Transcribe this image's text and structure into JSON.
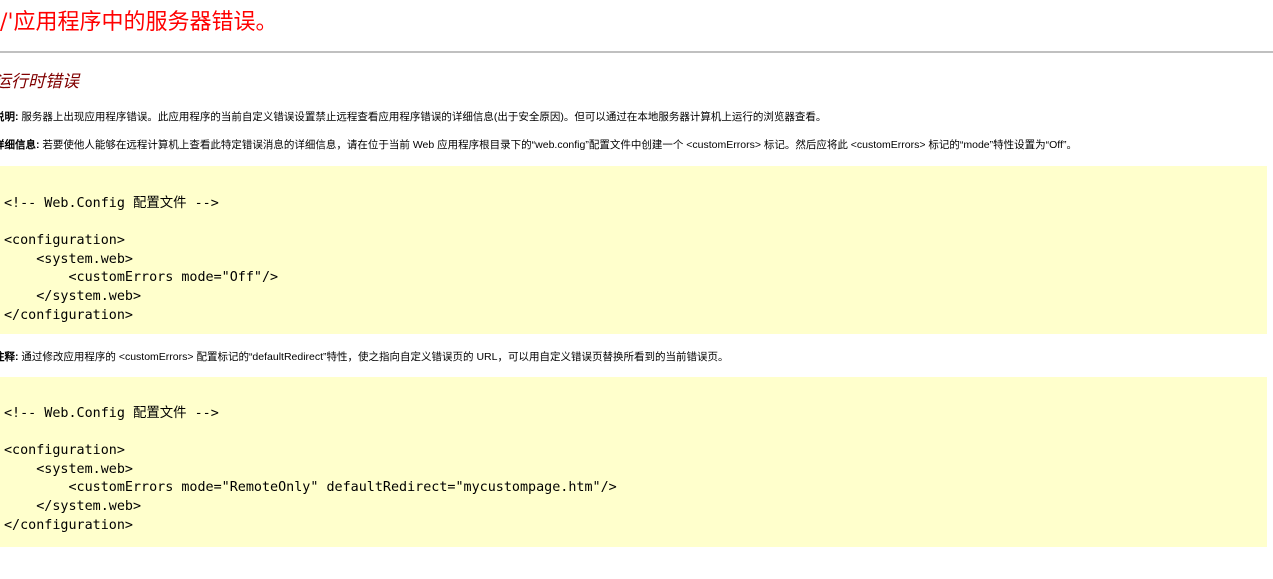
{
  "page": {
    "title": "'/'应用程序中的服务器错误。",
    "error_heading": "运行时错误",
    "description": {
      "label": "说明:",
      "text": " 服务器上出现应用程序错误。此应用程序的当前自定义错误设置禁止远程查看应用程序错误的详细信息(出于安全原因)。但可以通过在本地服务器计算机上运行的浏览器查看。"
    },
    "details": {
      "label": "详细信息:",
      "text": " 若要使他人能够在远程计算机上查看此特定错误消息的详细信息，请在位于当前 Web 应用程序根目录下的“web.config”配置文件中创建一个 <customErrors> 标记。然后应将此 <customErrors> 标记的“mode”特性设置为“Off”。"
    },
    "code_block_1": "<!-- Web.Config 配置文件 -->\n\n<configuration>\n    <system.web>\n        <customErrors mode=\"Off\"/>\n    </system.web>\n</configuration>",
    "notes": {
      "label": "注释:",
      "text": " 通过修改应用程序的 <customErrors> 配置标记的“defaultRedirect”特性，使之指向自定义错误页的 URL，可以用自定义错误页替换所看到的当前错误页。"
    },
    "code_block_2": "<!-- Web.Config 配置文件 -->\n\n<configuration>\n    <system.web>\n        <customErrors mode=\"RemoteOnly\" defaultRedirect=\"mycustompage.htm\"/>\n    </system.web>\n</configuration>"
  },
  "colors": {
    "title": "#ff0000",
    "error_heading": "#800000",
    "code_background": "#ffffcc",
    "rule": "#c0c0c0"
  }
}
